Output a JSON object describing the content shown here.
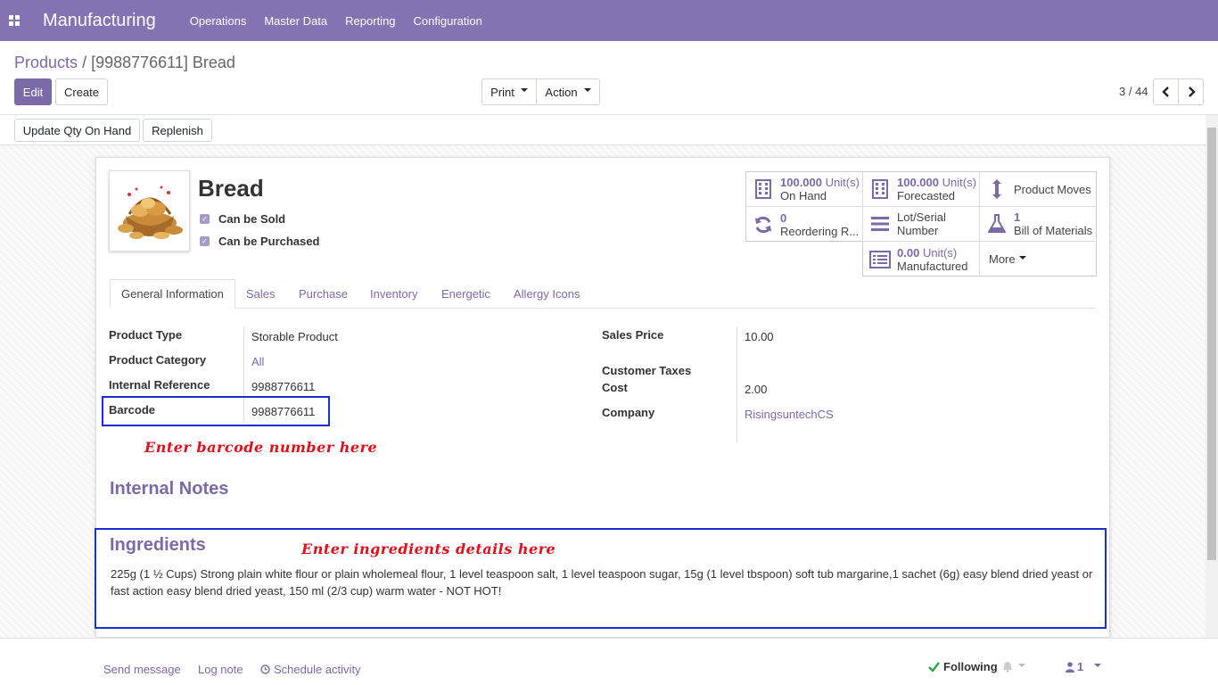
{
  "nav": {
    "app_name": "Manufacturing",
    "menus": [
      "Operations",
      "Master Data",
      "Reporting",
      "Configuration"
    ]
  },
  "breadcrumb": {
    "parent": "Products",
    "separator": "/",
    "current": "[9988776611] Bread"
  },
  "toolbar": {
    "edit": "Edit",
    "create": "Create",
    "print": "Print",
    "action": "Action"
  },
  "pager": {
    "value": "3 / 44"
  },
  "statusbar": {
    "update_qty": "Update Qty On Hand",
    "replenish": "Replenish"
  },
  "product": {
    "name": "Bread",
    "can_be_sold": "Can be Sold",
    "can_be_purchased": "Can be Purchased"
  },
  "smart_buttons": {
    "on_hand_value": "100.000",
    "on_hand_unit": "Unit(s)",
    "on_hand_label": "On Hand",
    "forecasted_value": "100.000",
    "forecasted_unit": "Unit(s)",
    "forecasted_label": "Forecasted",
    "product_moves": "Product Moves",
    "reordering_value": "0",
    "reordering_label": "Reordering R...",
    "lot_serial_1": "Lot/Serial",
    "lot_serial_2": "Number",
    "bom_value": "1",
    "bom_label": "Bill of Materials",
    "manufactured_value": "0.00",
    "manufactured_unit": "Unit(s)",
    "manufactured_label": "Manufactured",
    "more": "More"
  },
  "tabs": [
    "General Information",
    "Sales",
    "Purchase",
    "Inventory",
    "Energetic",
    "Allergy Icons"
  ],
  "fields_left": {
    "product_type_label": "Product Type",
    "product_type": "Storable Product",
    "product_category_label": "Product Category",
    "product_category": "All",
    "internal_reference_label": "Internal Reference",
    "internal_reference": "9988776611",
    "barcode_label": "Barcode",
    "barcode": "9988776611"
  },
  "fields_right": {
    "sales_price_label": "Sales Price",
    "sales_price": "10.00",
    "customer_taxes_label": "Customer Taxes",
    "cost_label": "Cost",
    "cost": "2.00",
    "company_label": "Company",
    "company": "RisingsuntechCS"
  },
  "annotations": {
    "barcode_hint": "Enter barcode number here",
    "ingredients_hint": "Enter ingredients details here"
  },
  "internal_notes_title": "Internal Notes",
  "ingredients": {
    "title": "Ingredients",
    "line1": "225g (1 ½ Cups) Strong plain white flour or plain wholemeal flour, 1 level teaspoon salt, 1 level teaspoon sugar, 15g (1 level tbspoon) soft tub margarine,1 sachet (6g) easy blend dried yeast or",
    "line2": "fast action easy blend dried yeast, 150 ml (2/3 cup) warm water - NOT HOT!"
  },
  "chatter": {
    "send_message": "Send message",
    "log_note": "Log note",
    "schedule_activity": "Schedule activity",
    "following": "Following",
    "followers_count": "1"
  },
  "colors": {
    "brand": "#8472b2",
    "link": "#7c6aa8",
    "annotation": "#e0101a",
    "highlight_box": "#1a2fd1"
  }
}
